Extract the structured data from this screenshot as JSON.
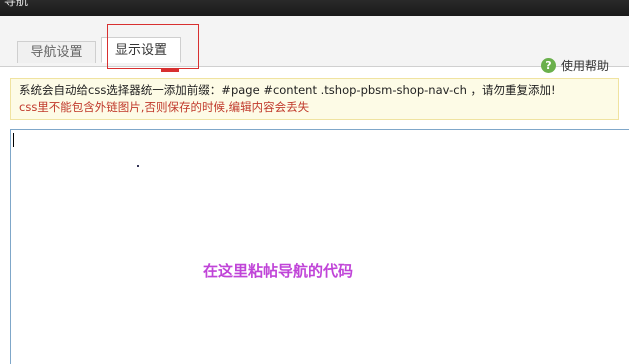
{
  "window": {
    "title": "导航"
  },
  "tabs": [
    {
      "label": "导航设置",
      "active": false
    },
    {
      "label": "显示设置",
      "active": true
    }
  ],
  "help": {
    "label": "使用帮助",
    "icon": "question-circle-icon",
    "icon_glyph": "?",
    "icon_color": "#6ab04c"
  },
  "notice": {
    "line1": "系统会自动给css选择器统一添加前缀：#page #content .tshop-pbsm-shop-nav-ch ，请勿重复添加!",
    "line2": "css里不能包含外链图片,否则保存的时候,编辑内容会丢失"
  },
  "editor": {
    "hint": "在这里粘帖导航的代码"
  },
  "colors": {
    "annotation": "#d83030",
    "hint": "#c044d8",
    "warning": "#c0392b"
  }
}
